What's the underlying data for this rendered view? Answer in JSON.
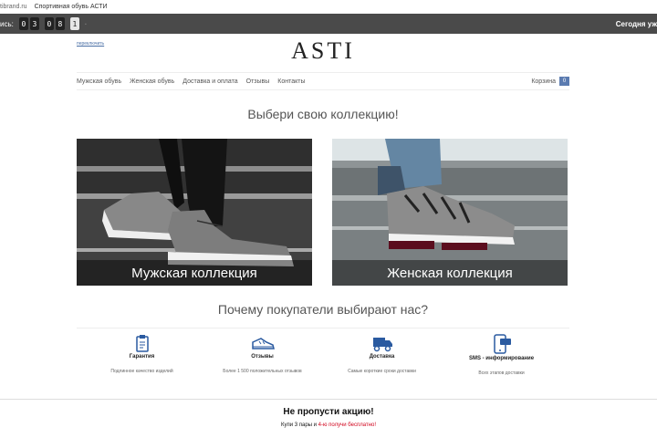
{
  "browser": {
    "url": "tibrand.ru",
    "tab_title": "Спортивная обувь АСТИ"
  },
  "topbar": {
    "label": "ись:",
    "digits": [
      "0",
      "3",
      "0",
      "8",
      "1",
      "·"
    ],
    "right_text": "Сегодня уж"
  },
  "header": {
    "lang_link": "переключить",
    "logo": "ASTI"
  },
  "nav": {
    "items": [
      "Мужская обувь",
      "Женская обувь",
      "Доставка и оплата",
      "Отзывы",
      "Контакты"
    ],
    "cart_label": "Корзина",
    "cart_count": "0"
  },
  "collections": {
    "heading": "Выбери свою коллекцию!",
    "men": "Мужская коллекция",
    "women": "Женская коллекция"
  },
  "why": {
    "heading": "Почему покупатели выбирают нас?",
    "features": [
      {
        "title": "Гарантия",
        "desc": "Подлинное качество изделий",
        "icon": "clipboard-icon"
      },
      {
        "title": "Отзывы",
        "desc": "Более 1 500 положительных отзывов",
        "icon": "sneaker-icon"
      },
      {
        "title": "Доставка",
        "desc": "Самые короткие сроки доставки",
        "icon": "truck-icon"
      },
      {
        "title": "SMS - информирование",
        "desc": "Всех этапов доставки",
        "icon": "phone-sms-icon"
      }
    ],
    "accent_color": "#2a5aa0"
  },
  "promo": {
    "title": "Не пропусти акцию!",
    "text_before": "Купи 3 пары и ",
    "text_highlight": "4-ю получи бесплатно!",
    "highlight_color": "#d0021b"
  }
}
